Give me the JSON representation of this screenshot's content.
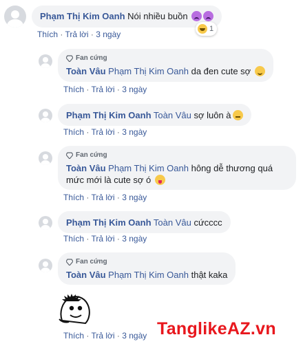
{
  "comments": [
    {
      "author": "Phạm Thị Kim Oanh",
      "text": "Nói nhiều buồn",
      "emoji": [
        "sad-face-icon",
        "sad-face-icon"
      ],
      "reaction_count": "1",
      "actions": {
        "like": "Thích",
        "reply": "Trả lời",
        "time": "3 ngày"
      }
    },
    {
      "badge": "Fan cứng",
      "author": "Toàn Vâu",
      "tag": "Phạm Thị Kim Oanh",
      "text": "da đen cute sợ",
      "actions": {
        "like": "Thích",
        "reply": "Trả lời",
        "time": "3 ngày"
      }
    },
    {
      "author": "Phạm Thị Kim Oanh",
      "tag": "Toàn Vâu",
      "text": "sợ luôn à",
      "actions": {
        "like": "Thích",
        "reply": "Trả lời",
        "time": "3 ngày"
      }
    },
    {
      "badge": "Fan cứng",
      "author": "Toàn Vâu",
      "tag": "Phạm Thị Kim Oanh",
      "text_line1": "hông dễ thương quá",
      "text_line2": "mức mới là cute sợ ó",
      "actions": {
        "like": "Thích",
        "reply": "Trả lời",
        "time": "3 ngày"
      }
    },
    {
      "author": "Phạm Thị Kim Oanh",
      "tag": "Toàn Vâu",
      "text": "cứcccc",
      "actions": {
        "like": "Thích",
        "reply": "Trả lời",
        "time": "3 ngày"
      }
    },
    {
      "badge": "Fan cứng",
      "author": "Toàn Vâu",
      "tag": "Phạm Thị Kim Oanh",
      "text": "thật kaka",
      "actions": {
        "like": "Thích",
        "reply": "Trả lời",
        "time": "3 ngày"
      }
    },
    {
      "sticker": "cartoon-sticker",
      "actions": {
        "like": "Thích",
        "reply": "Trả lời",
        "time": "3 ngày"
      }
    }
  ],
  "watermark": "TanglikeAZ.vn",
  "colors": {
    "name": "#385898",
    "bubble": "#f2f3f5",
    "meta": "#606770",
    "watermark": "#e8171d"
  }
}
